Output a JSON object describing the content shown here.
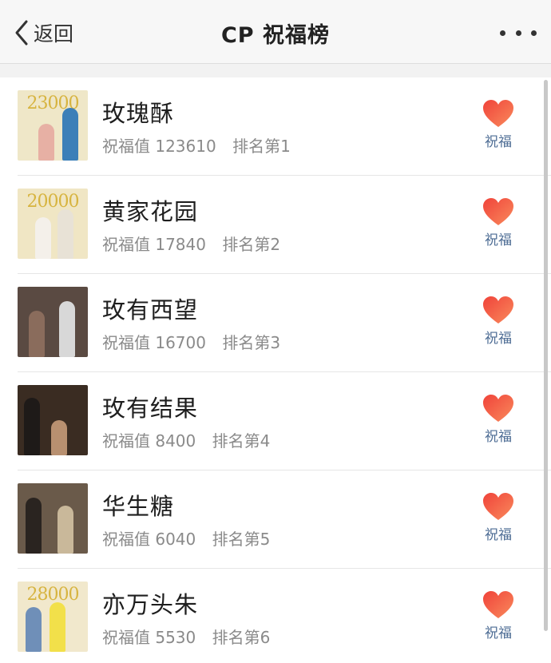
{
  "header": {
    "back_label": "返回",
    "title": "CP 祝福榜",
    "more_icon": "more-dots-icon"
  },
  "accent": {
    "heart": "#f0433a",
    "heart_light": "#f98a5c",
    "link": "#4d6c94"
  },
  "list": {
    "value_prefix": "祝福值",
    "items": [
      {
        "name": "玫瑰酥",
        "value": "123610",
        "rank": "排名第1",
        "action": "祝福",
        "poster_text": "23000",
        "poster_bg": "#efe7c8"
      },
      {
        "name": "黄家花园",
        "value": "17840",
        "rank": "排名第2",
        "action": "祝福",
        "poster_text": "20000",
        "poster_bg": "#f0e6c4"
      },
      {
        "name": "玫有西望",
        "value": "16700",
        "rank": "排名第3",
        "action": "祝福",
        "poster_text": "",
        "poster_bg": "#5a4a42"
      },
      {
        "name": "玫有结果",
        "value": "8400",
        "rank": "排名第4",
        "action": "祝福",
        "poster_text": "",
        "poster_bg": "#3a2c22"
      },
      {
        "name": "华生糖",
        "value": "6040",
        "rank": "排名第5",
        "action": "祝福",
        "poster_text": "",
        "poster_bg": "#6a5a4a"
      },
      {
        "name": "亦万头朱",
        "value": "5530",
        "rank": "排名第6",
        "action": "祝福",
        "poster_text": "28000",
        "poster_bg": "#f1e8cc"
      }
    ]
  }
}
